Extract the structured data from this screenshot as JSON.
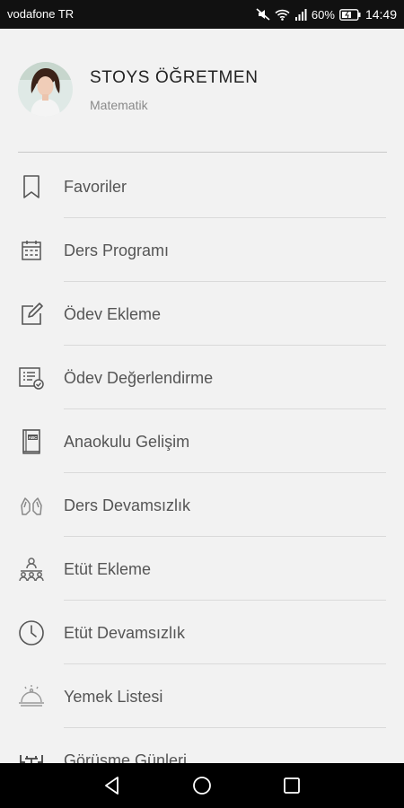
{
  "status_bar": {
    "carrier": "vodafone TR",
    "battery_percent": "60%",
    "time": "14:49"
  },
  "profile": {
    "name": "STOYS ÖĞRETMEN",
    "subject": "Matematik"
  },
  "menu": {
    "items": [
      {
        "label": "Favoriler",
        "icon": "bookmark-icon"
      },
      {
        "label": "Ders Programı",
        "icon": "calendar-icon"
      },
      {
        "label": "Ödev Ekleme",
        "icon": "edit-icon"
      },
      {
        "label": "Ödev Değerlendirme",
        "icon": "checklist-icon"
      },
      {
        "label": "Anaokulu Gelişim",
        "icon": "abc-book-icon"
      },
      {
        "label": "Ders Devamsızlık",
        "icon": "raised-hands-icon"
      },
      {
        "label": "Etüt Ekleme",
        "icon": "group-icon"
      },
      {
        "label": "Etüt Devamsızlık",
        "icon": "clock-icon"
      },
      {
        "label": "Yemek Listesi",
        "icon": "food-tray-icon"
      },
      {
        "label": "Görüşme Günleri",
        "icon": "meeting-table-icon"
      }
    ]
  },
  "colors": {
    "background": "#f2f2f2",
    "status_bar": "#111111",
    "nav_bar": "#000000",
    "text": "#555555",
    "divider": "#dadada"
  }
}
